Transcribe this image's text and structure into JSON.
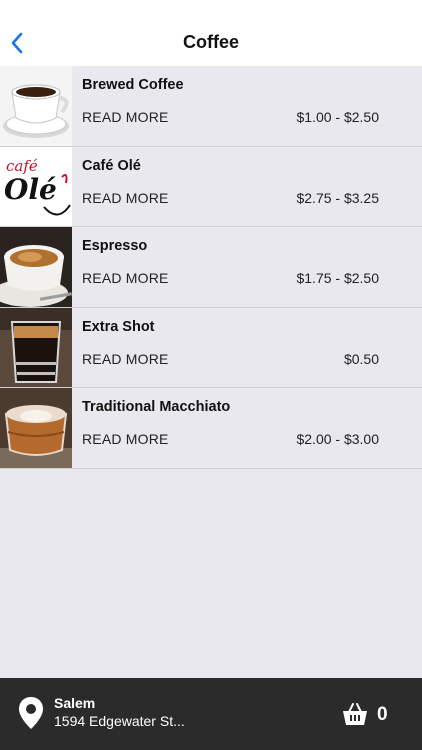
{
  "header": {
    "title": "Coffee",
    "back_icon": "chevron-left-icon",
    "accent": "#1a73e8"
  },
  "items": [
    {
      "name": "Brewed Coffee",
      "action": "READ MORE",
      "price": "$1.00 - $2.50"
    },
    {
      "name": "Café Olé",
      "action": "READ MORE",
      "price": "$2.75 - $3.25",
      "logo_text_top": "café",
      "logo_text_bottom": "Olé"
    },
    {
      "name": "Espresso",
      "action": "READ MORE",
      "price": "$1.75 - $2.50"
    },
    {
      "name": "Extra Shot",
      "action": "READ MORE",
      "price": "$0.50"
    },
    {
      "name": "Traditional Macchiato",
      "action": "READ MORE",
      "price": "$2.00 - $3.00"
    }
  ],
  "footer": {
    "location_name": "Salem",
    "location_address": "1594 Edgewater St...",
    "cart_count": "0",
    "pin_icon": "map-pin-icon",
    "cart_icon": "basket-icon"
  }
}
